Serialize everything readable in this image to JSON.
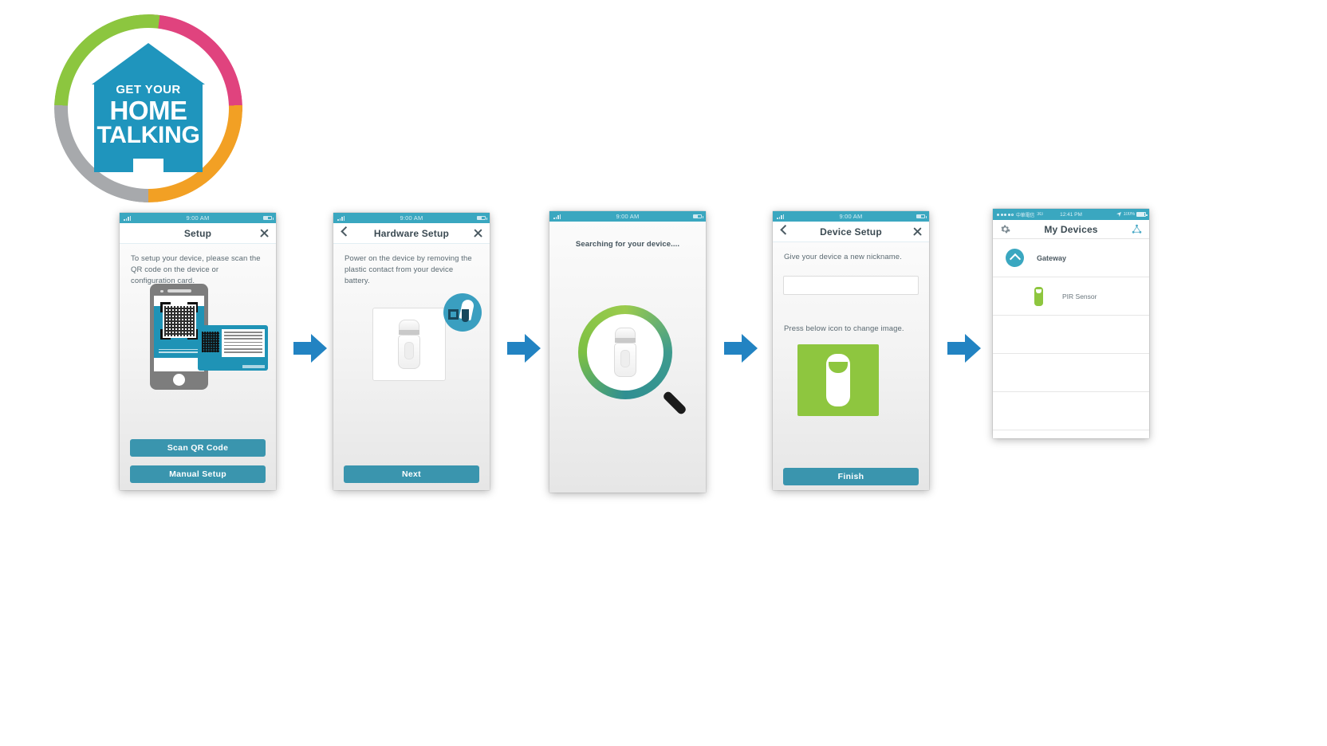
{
  "logo": {
    "line1": "GET YOUR",
    "line2": "HOME",
    "line3": "TALKING",
    "colors": {
      "teal": "#1f95bd",
      "green": "#8cc63f",
      "pink": "#e0437e",
      "orange": "#f2a024",
      "gray": "#a7a9ac"
    }
  },
  "accent": {
    "teal": "#3a95ae",
    "statusbar": "#3aa7c0",
    "green": "#8ec63f",
    "arrow": "#2283c2"
  },
  "screens": [
    {
      "id": "setup",
      "status_time": "9:00 AM",
      "title": "Setup",
      "has_back": false,
      "has_close": true,
      "instruction": "To setup your device, please scan the QR code on the device or configuration card.",
      "buttons": [
        {
          "label": "Scan QR Code"
        },
        {
          "label": "Manual Setup"
        }
      ]
    },
    {
      "id": "hardware-setup",
      "status_time": "9:00 AM",
      "title": "Hardware Setup",
      "has_back": true,
      "has_close": true,
      "instruction": "Power on the device by removing the plastic contact from your device battery.",
      "buttons": [
        {
          "label": "Next"
        }
      ]
    },
    {
      "id": "searching",
      "status_time": "9:00 AM",
      "title": "",
      "has_back": false,
      "has_close": false,
      "instruction": "Searching for your device....",
      "buttons": []
    },
    {
      "id": "device-setup",
      "status_time": "9:00 AM",
      "title": "Device Setup",
      "has_back": true,
      "has_close": true,
      "instruction": "Give your device a new nickname.",
      "nickname_value": "",
      "nickname_placeholder": "",
      "instruction2": "Press below icon to change image.",
      "buttons": [
        {
          "label": "Finish"
        }
      ]
    }
  ],
  "my_devices": {
    "status": {
      "carrier": "中華電信",
      "network": "3G",
      "time": "12:41 PM",
      "battery": "100%"
    },
    "title": "My Devices",
    "gear_icon": "gear-icon",
    "node_icon": "network-node-icon",
    "rows": [
      {
        "label": "Gateway",
        "type": "group",
        "icon": "chevron-up-circle-icon"
      },
      {
        "label": "PIR Sensor",
        "type": "device",
        "icon": "pir-sensor-icon"
      },
      {
        "label": "",
        "type": "empty",
        "icon": ""
      },
      {
        "label": "",
        "type": "empty",
        "icon": ""
      },
      {
        "label": "",
        "type": "empty",
        "icon": ""
      }
    ]
  },
  "arrows": [
    {
      "name": "arrow-1"
    },
    {
      "name": "arrow-2"
    },
    {
      "name": "arrow-3"
    },
    {
      "name": "arrow-4"
    }
  ]
}
